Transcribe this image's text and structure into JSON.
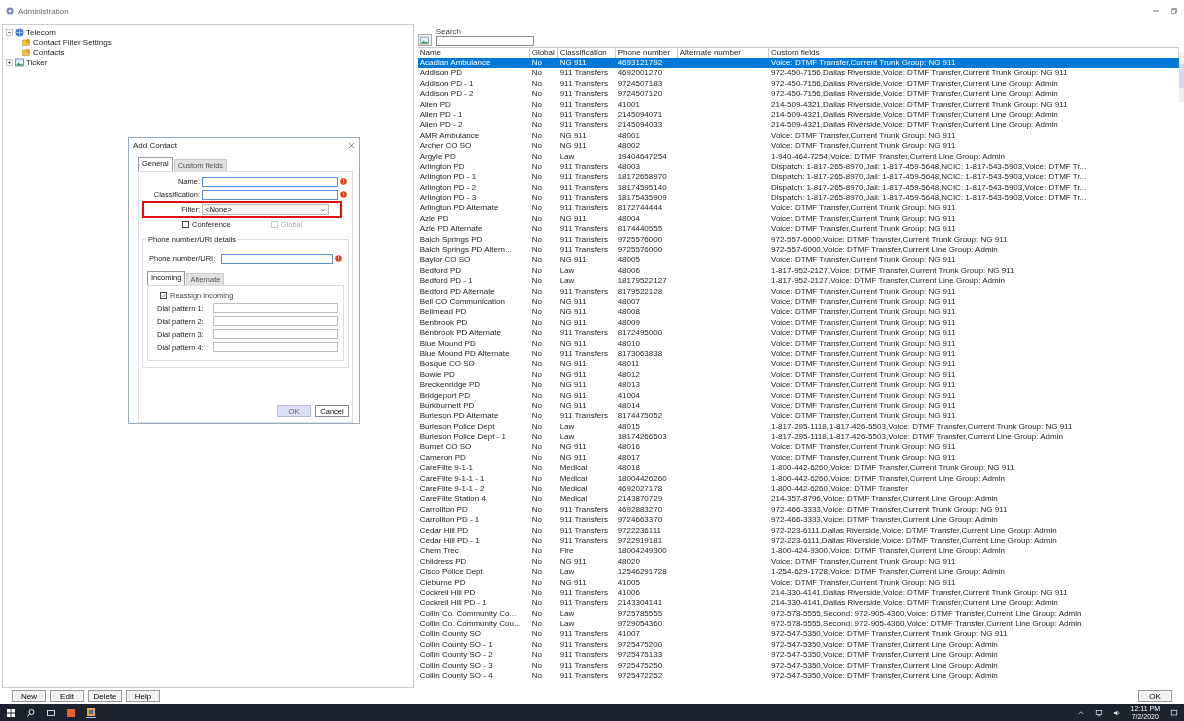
{
  "window": {
    "title": "Administration"
  },
  "tree": [
    {
      "label": "Telecom",
      "expanded": true,
      "children": [
        {
          "label": "Contact Filter Settings"
        },
        {
          "label": "Contacts"
        }
      ]
    },
    {
      "label": "Ticker",
      "expanded": false
    }
  ],
  "search": {
    "label": "Search"
  },
  "table": {
    "columns": [
      "Name",
      "Global",
      "Classification",
      "Phone number",
      "Alternate number",
      "Custom fields"
    ],
    "rows": [
      {
        "name": "Acadian Ambulance",
        "global": "No",
        "classification": "NG 911",
        "phone": "4693121792",
        "custom": "Voice: DTMF Transfer,Current Trunk Group: NG 911",
        "selected": true
      },
      {
        "name": "Addison PD",
        "global": "No",
        "classification": "911 Transfers",
        "phone": "4692001270",
        "custom": "972-450-7156,Dallas Riverside,Voice: DTMF Transfer,Current Trunk Group: NG 911",
        "selected": false
      },
      {
        "name": "Addison PD - 1",
        "global": "No",
        "classification": "911 Transfers",
        "phone": "9724507183",
        "custom": "972-450-7156,Dallas Riverside,Voice: DTMF Transfer,Current Line Group: Admin",
        "selected": false
      },
      {
        "name": "Addison PD - 2",
        "global": "No",
        "classification": "911 Transfers",
        "phone": "9724507120",
        "custom": "972-450-7156,Dallas Riverside,Voice: DTMF Transfer,Current Line Group: Admin",
        "selected": false
      },
      {
        "name": "Allen PD",
        "global": "No",
        "classification": "911 Transfers",
        "phone": "41001",
        "custom": "214-509-4321,Dallas Riverside,Voice: DTMF Transfer,Current Trunk Group: NG 911",
        "selected": false
      },
      {
        "name": "Allen PD - 1",
        "global": "No",
        "classification": "911 Transfers",
        "phone": "2145094071",
        "custom": "214-509-4321,Dallas Riverside,Voice: DTMF Transfer,Current Line Group: Admin",
        "selected": false
      },
      {
        "name": "Allen PD - 2",
        "global": "No",
        "classification": "911 Transfers",
        "phone": "2145094033",
        "custom": "214-509-4321,Dallas Riverside,Voice: DTMF Transfer,Current Line Group: Admin",
        "selected": false
      },
      {
        "name": "AMR Ambulance",
        "global": "No",
        "classification": "NG 911",
        "phone": "48001",
        "custom": "Voice: DTMF Transfer,Current Trunk Group: NG 911",
        "selected": false
      },
      {
        "name": "Archer CO SO",
        "global": "No",
        "classification": "NG 911",
        "phone": "48002",
        "custom": "Voice: DTMF Transfer,Current Trunk Group: NG 911",
        "selected": false
      },
      {
        "name": "Argyle PD",
        "global": "No",
        "classification": "Law",
        "phone": "19404647254",
        "custom": "1-940-464-7254,Voice: DTMF Transfer,Current Line Group: Admin",
        "selected": false
      },
      {
        "name": "Arlington PD",
        "global": "No",
        "classification": "911 Transfers",
        "phone": "48003",
        "custom": "Dispatch: 1-817-265-8970,Jail: 1-817-459-5648,NCIC: 1-817-543-5903,Voice: DTMF Tr...",
        "selected": false
      },
      {
        "name": "Arlington PD - 1",
        "global": "No",
        "classification": "911 Transfers",
        "phone": "18172658970",
        "custom": "Dispatch: 1-817-265-8970,Jail: 1-817-459-5648,NCIC: 1-817-543-5903,Voice: DTMF Tr...",
        "selected": false
      },
      {
        "name": "Arlington PD - 2",
        "global": "No",
        "classification": "911 Transfers",
        "phone": "18174595140",
        "custom": "Dispatch: 1-817-265-8970,Jail: 1-817-459-5648,NCIC: 1-817-543-5903,Voice: DTMF Tr...",
        "selected": false
      },
      {
        "name": "Arlington PD - 3",
        "global": "No",
        "classification": "911 Transfers",
        "phone": "18175435909",
        "custom": "Dispatch: 1-817-265-8970,Jail: 1-817-459-5648,NCIC: 1-817-543-5903,Voice: DTMF Tr...",
        "selected": false
      },
      {
        "name": "Arlington PD Alternate",
        "global": "No",
        "classification": "911 Transfers",
        "phone": "8172744444",
        "custom": "Voice: DTMF Transfer,Current Trunk Group: NG 911",
        "selected": false
      },
      {
        "name": "Azle PD",
        "global": "No",
        "classification": "NG 911",
        "phone": "48004",
        "custom": "Voice: DTMF Transfer,Current Trunk Group: NG 911",
        "selected": false
      },
      {
        "name": "Azle PD Alternate",
        "global": "No",
        "classification": "911 Transfers",
        "phone": "8174440555",
        "custom": "Voice: DTMF Transfer,Current Trunk Group: NG 911",
        "selected": false
      },
      {
        "name": "Balch Springs PD",
        "global": "No",
        "classification": "911 Transfers",
        "phone": "9725576000",
        "custom": "972-557-6000,Voice: DTMF Transfer,Current Trunk Group: NG 911",
        "selected": false
      },
      {
        "name": "Balch Springs PD Altern...",
        "global": "No",
        "classification": "911 Transfers",
        "phone": "9725576000",
        "custom": "972-557-6000,Voice: DTMF Transfer,Current Line Group: Admin",
        "selected": false
      },
      {
        "name": "Baylor CO SO",
        "global": "No",
        "classification": "NG 911",
        "phone": "48005",
        "custom": "Voice: DTMF Transfer,Current Trunk Group: NG 911",
        "selected": false
      },
      {
        "name": "Bedford PD",
        "global": "No",
        "classification": "Law",
        "phone": "48006",
        "custom": "1-817-952-2127,Voice: DTMF Transfer,Current Trunk Group: NG 911",
        "selected": false
      },
      {
        "name": "Bedford PD - 1",
        "global": "No",
        "classification": "Law",
        "phone": "18179522127",
        "custom": "1-817-952-2127,Voice: DTMF Transfer,Current Line Group: Admin",
        "selected": false
      },
      {
        "name": "Bedford PD Alternate",
        "global": "No",
        "classification": "911 Transfers",
        "phone": "8179522128",
        "custom": "Voice: DTMF Transfer,Current Trunk Group: NG 911",
        "selected": false
      },
      {
        "name": "Bell CO Communication",
        "global": "No",
        "classification": "NG 911",
        "phone": "48007",
        "custom": "Voice: DTMF Transfer,Current Trunk Group: NG 911",
        "selected": false
      },
      {
        "name": "Bellmead PD",
        "global": "No",
        "classification": "NG 911",
        "phone": "48008",
        "custom": "Voice: DTMF Transfer,Current Trunk Group: NG 911",
        "selected": false
      },
      {
        "name": "Benbrook PD",
        "global": "No",
        "classification": "NG 911",
        "phone": "48009",
        "custom": "Voice: DTMF Transfer,Current Trunk Group: NG 911",
        "selected": false
      },
      {
        "name": "Benbrook PD Alternate",
        "global": "No",
        "classification": "911 Transfers",
        "phone": "8172495000",
        "custom": "Voice: DTMF Transfer,Current Trunk Group: NG 911",
        "selected": false
      },
      {
        "name": "Blue Mound PD",
        "global": "No",
        "classification": "NG 911",
        "phone": "48010",
        "custom": "Voice: DTMF Transfer,Current Trunk Group: NG 911",
        "selected": false
      },
      {
        "name": "Blue Mound PD Alternate",
        "global": "No",
        "classification": "911 Transfers",
        "phone": "8173063838",
        "custom": "Voice: DTMF Transfer,Current Trunk Group: NG 911",
        "selected": false
      },
      {
        "name": "Bosque CO SO",
        "global": "No",
        "classification": "NG 911",
        "phone": "48011",
        "custom": "Voice: DTMF Transfer,Current Trunk Group: NG 911",
        "selected": false
      },
      {
        "name": "Bowie PD",
        "global": "No",
        "classification": "NG 911",
        "phone": "48012",
        "custom": "Voice: DTMF Transfer,Current Trunk Group: NG 911",
        "selected": false
      },
      {
        "name": "Breckenridge PD",
        "global": "No",
        "classification": "NG 911",
        "phone": "48013",
        "custom": "Voice: DTMF Transfer,Current Trunk Group: NG 911",
        "selected": false
      },
      {
        "name": "Bridgeport PD",
        "global": "No",
        "classification": "NG 911",
        "phone": "41004",
        "custom": "Voice: DTMF Transfer,Current Trunk Group: NG 911",
        "selected": false
      },
      {
        "name": "Burkburnett PD",
        "global": "No",
        "classification": "NG 911",
        "phone": "48014",
        "custom": "Voice: DTMF Transfer,Current Trunk Group: NG 911",
        "selected": false
      },
      {
        "name": "Burleson PD Alternate",
        "global": "No",
        "classification": "911 Transfers",
        "phone": "8174475052",
        "custom": "Voice: DTMF Transfer,Current Trunk Group: NG 911",
        "selected": false
      },
      {
        "name": "Burleson Police Dept",
        "global": "No",
        "classification": "Law",
        "phone": "48015",
        "custom": "1-817-295-1118,1-817-426-5503,Voice: DTMF Transfer,Current Trunk Group: NG 911",
        "selected": false
      },
      {
        "name": "Burleson Police Dept - 1",
        "global": "No",
        "classification": "Law",
        "phone": "18174266503",
        "custom": "1-817-295-1118,1-817-426-5503,Voice: DTMF Transfer,Current Line Group: Admin",
        "selected": false
      },
      {
        "name": "Burnet CO SO",
        "global": "No",
        "classification": "NG 911",
        "phone": "48016",
        "custom": "Voice: DTMF Transfer,Current Trunk Group: NG 911",
        "selected": false
      },
      {
        "name": "Cameron PD",
        "global": "No",
        "classification": "NG 911",
        "phone": "48017",
        "custom": "Voice: DTMF Transfer,Current Trunk Group: NG 911",
        "selected": false
      },
      {
        "name": "CareFlite 9-1-1",
        "global": "No",
        "classification": "Medical",
        "phone": "48018",
        "custom": "1-800-442-6260,Voice: DTMF Transfer,Current Trunk Group: NG 911",
        "selected": false
      },
      {
        "name": "CareFlite 9-1-1 - 1",
        "global": "No",
        "classification": "Medical",
        "phone": "18004426260",
        "custom": "1-800-442-6260,Voice: DTMF Transfer,Current Line Group: Admin",
        "selected": false
      },
      {
        "name": "CareFlite 9-1-1 - 2",
        "global": "No",
        "classification": "Medical",
        "phone": "4692027178",
        "custom": "1-800-442-6260,Voice: DTMF Transfer",
        "selected": false
      },
      {
        "name": "CareFlite Station 4",
        "global": "No",
        "classification": "Medical",
        "phone": "2143870729",
        "custom": "214-357-8796,Voice: DTMF Transfer,Current Line Group: Admin",
        "selected": false
      },
      {
        "name": "Carrollton PD",
        "global": "No",
        "classification": "911 Transfers",
        "phone": "4692883270",
        "custom": "972-466-3333,Voice: DTMF Transfer,Current Trunk Group: NG 911",
        "selected": false
      },
      {
        "name": "Carrollton PD - 1",
        "global": "No",
        "classification": "911 Transfers",
        "phone": "9724663370",
        "custom": "972-466-3333,Voice: DTMF Transfer,Current Line Group: Admin",
        "selected": false
      },
      {
        "name": "Cedar Hill PD",
        "global": "No",
        "classification": "911 Transfers",
        "phone": "9722236111",
        "custom": "972-223-6111,Dallas Riverside,Voice: DTMF Transfer,Current Line Group: Admin",
        "selected": false
      },
      {
        "name": "Cedar Hill PD - 1",
        "global": "No",
        "classification": "911 Transfers",
        "phone": "9722919181",
        "custom": "972-223-6111,Dallas Riverside,Voice: DTMF Transfer,Current Line Group: Admin",
        "selected": false
      },
      {
        "name": "Chem Trec",
        "global": "No",
        "classification": "Fire",
        "phone": "18004249300",
        "custom": "1-800-424-9300,Voice: DTMF Transfer,Current Line Group: Admin",
        "selected": false
      },
      {
        "name": "Childress PD",
        "global": "No",
        "classification": "NG 911",
        "phone": "48020",
        "custom": "Voice: DTMF Transfer,Current Trunk Group: NG 911",
        "selected": false
      },
      {
        "name": "Cisco Police Dept",
        "global": "No",
        "classification": "Law",
        "phone": "12546291728",
        "custom": "1-254-629-1728,Voice: DTMF Transfer,Current Line Group: Admin",
        "selected": false
      },
      {
        "name": "Cleburne PD",
        "global": "No",
        "classification": "NG 911",
        "phone": "41005",
        "custom": "Voice: DTMF Transfer,Current Trunk Group: NG 911",
        "selected": false
      },
      {
        "name": "Cockrell Hill PD",
        "global": "No",
        "classification": "911 Transfers",
        "phone": "41006",
        "custom": "214-330-4141,Dallas Riverside,Voice: DTMF Transfer,Current Trunk Group: NG 911",
        "selected": false
      },
      {
        "name": "Cockrell Hill PD - 1",
        "global": "No",
        "classification": "911 Transfers",
        "phone": "2143304141",
        "custom": "214-330-4141,Dallas Riverside,Voice: DTMF Transfer,Current Line Group: Admin",
        "selected": false
      },
      {
        "name": "Collin Co. Community Co...",
        "global": "No",
        "classification": "Law",
        "phone": "9725785555",
        "custom": "972-578-5555,Second: 972-905-4360,Voice: DTMF Transfer,Current Line Group: Admin",
        "selected": false
      },
      {
        "name": "Collin Co. Community Cou...",
        "global": "No",
        "classification": "Law",
        "phone": "9729054360",
        "custom": "972-578-5555,Second: 972-905-4360,Voice: DTMF Transfer,Current Line Group: Admin",
        "selected": false
      },
      {
        "name": "Collin County SO",
        "global": "No",
        "classification": "911 Transfers",
        "phone": "41007",
        "custom": "972-547-5350,Voice: DTMF Transfer,Current Trunk Group: NG 911",
        "selected": false
      },
      {
        "name": "Collin County SO - 1",
        "global": "No",
        "classification": "911 Transfers",
        "phone": "9725475200",
        "custom": "972-547-5350,Voice: DTMF Transfer,Current Line Group: Admin",
        "selected": false
      },
      {
        "name": "Collin County SO - 2",
        "global": "No",
        "classification": "911 Transfers",
        "phone": "9725475133",
        "custom": "972-547-5350,Voice: DTMF Transfer,Current Line Group: Admin",
        "selected": false
      },
      {
        "name": "Collin County SO - 3",
        "global": "No",
        "classification": "911 Transfers",
        "phone": "9725475250",
        "custom": "972-547-5350,Voice: DTMF Transfer,Current Line Group: Admin",
        "selected": false
      },
      {
        "name": "Collin County SO - 4",
        "global": "No",
        "classification": "911 Transfers",
        "phone": "9725472252",
        "custom": "972-547-5350,Voice: DTMF Transfer,Current Line Group: Admin",
        "selected": false
      }
    ]
  },
  "dialog": {
    "title": "Add Contact",
    "tabs": [
      {
        "label": "General",
        "selected": true
      },
      {
        "label": "Custom fields",
        "selected": false
      }
    ],
    "fields": [
      {
        "label": "Name:",
        "kind": "text",
        "required": true
      },
      {
        "label": "Classification:",
        "kind": "text",
        "required": true
      },
      {
        "label": "Filter:",
        "kind": "dropdown",
        "value": "<None>",
        "highlighted": true
      }
    ],
    "checkboxes": [
      {
        "label": "Conference",
        "checked": false,
        "disabled": false
      },
      {
        "label": "Global",
        "checked": false,
        "disabled": true
      }
    ],
    "group": {
      "title": "Phone number/URI details",
      "phone_label": "Phone number/URI:",
      "phone_required": true,
      "tabs": [
        {
          "label": "Incoming",
          "selected": true
        },
        {
          "label": "Alternate",
          "selected": false
        }
      ],
      "reassign": {
        "label": "Reassign incoming",
        "checked": true
      },
      "dial_patterns": [
        "Dial pattern 1:",
        "Dial pattern 2:",
        "Dial pattern 3:",
        "Dial pattern 4:"
      ]
    },
    "buttons": [
      {
        "label": "OK",
        "disabled": true
      },
      {
        "label": "Cancel",
        "disabled": false
      }
    ]
  },
  "buttons": [
    "New",
    "Edit",
    "Delete",
    "Help"
  ],
  "ok_button": "OK",
  "taskbar": {
    "time": "12:11 PM",
    "date": "7/2/2020"
  }
}
